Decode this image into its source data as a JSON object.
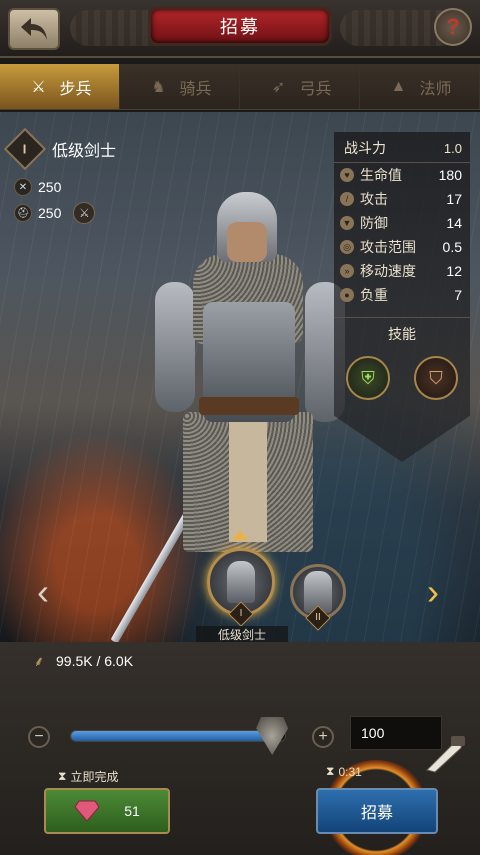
{
  "header": {
    "title": "招募",
    "help_symbol": "?"
  },
  "tabs": [
    {
      "label": "步兵",
      "active": true
    },
    {
      "label": "骑兵",
      "active": false
    },
    {
      "label": "弓兵",
      "active": false
    },
    {
      "label": "法师",
      "active": false
    }
  ],
  "unit": {
    "tier": "I",
    "name": "低级剑士",
    "attack_stat": "250",
    "defense_stat": "250"
  },
  "stats_panel": {
    "power_label": "战斗力",
    "power_value": "1.0",
    "rows": [
      {
        "label": "生命值",
        "value": "180",
        "icon": "heart-icon"
      },
      {
        "label": "攻击",
        "value": "17",
        "icon": "sword-icon"
      },
      {
        "label": "防御",
        "value": "14",
        "icon": "shield-icon"
      },
      {
        "label": "攻击范围",
        "value": "0.5",
        "icon": "target-icon"
      },
      {
        "label": "移动速度",
        "value": "12",
        "icon": "wing-icon"
      },
      {
        "label": "负重",
        "value": "7",
        "icon": "bag-icon"
      }
    ],
    "skills_label": "技能",
    "skills": [
      {
        "icon": "shield-skill-icon"
      },
      {
        "icon": "armor-skill-icon"
      }
    ]
  },
  "carousel": {
    "selected_label": "低级剑士",
    "selected_tier": "I",
    "next_tier": "II"
  },
  "resource": {
    "food": "99.5K / 6.0K"
  },
  "quantity": {
    "value": "100",
    "fill_fraction": 0.94
  },
  "instant": {
    "label": "立即完成",
    "cost": "51"
  },
  "recruit": {
    "timer": "0:31",
    "label": "招募"
  },
  "colors": {
    "accent_gold": "#c79b3b",
    "recruit_blue": "#2e6fae",
    "instant_green": "#4d8b36",
    "title_red": "#b3262a"
  }
}
